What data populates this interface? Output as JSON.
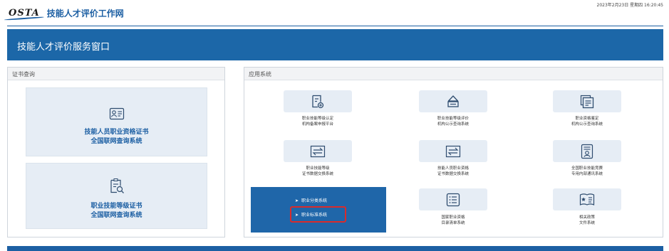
{
  "header": {
    "logo_text": "OSTA",
    "site_title": "技能人才评价工作网",
    "datetime": "2023年2月23日  星期四 16:20:45"
  },
  "banner": {
    "title": "技能人才评价服务窗口"
  },
  "cert_panel": {
    "title": "证书查询",
    "cards": [
      {
        "line1": "技能人员职业资格证书",
        "line2": "全国联网查询系统",
        "icon": "certificate-person-icon"
      },
      {
        "line1": "职业技能等级证书",
        "line2": "全国联网查询系统",
        "icon": "document-search-icon"
      }
    ]
  },
  "app_panel": {
    "title": "应用系统",
    "apps": [
      {
        "line1": "职业技能等级认定",
        "line2": "机构备案申报平台",
        "icon": "document-add-icon"
      },
      {
        "line1": "职业技能等级评价",
        "line2": "机构公示查询系统",
        "icon": "bell-icon"
      },
      {
        "line1": "职业资格鉴定",
        "line2": "机构公示查询系统",
        "icon": "documents-icon"
      },
      {
        "line1": "职业技能等级",
        "line2": "证书数据交换系统",
        "icon": "exchange-icon"
      },
      {
        "line1": "技能人员职业资格",
        "line2": "证书数据交换系统",
        "icon": "exchange-icon"
      },
      {
        "line1": "全国职业技能竞赛",
        "line2": "专用内部通讯系统",
        "icon": "document-person-icon"
      },
      {
        "line1": "国家职业资格",
        "line2": "目录清单系统",
        "icon": "list-icon"
      },
      {
        "line1": "相关政策",
        "line2": "文件系统",
        "icon": "star-book-icon"
      }
    ],
    "sub_links": [
      {
        "label": "职业分类系统"
      },
      {
        "label": "职业标准系统"
      }
    ]
  }
}
